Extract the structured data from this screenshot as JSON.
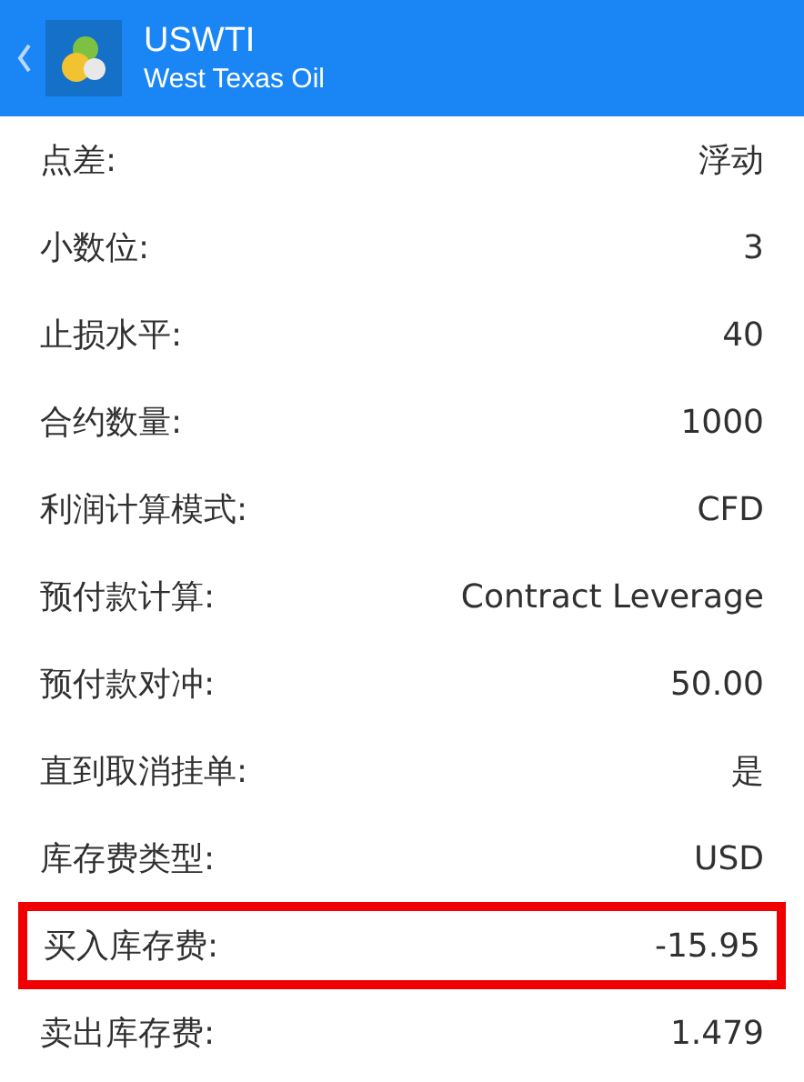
{
  "header": {
    "title": "USWTI",
    "subtitle": "West Texas Oil"
  },
  "rows": [
    {
      "label": "点差:",
      "value": "浮动",
      "highlighted": false
    },
    {
      "label": "小数位:",
      "value": "3",
      "highlighted": false
    },
    {
      "label": "止损水平:",
      "value": "40",
      "highlighted": false
    },
    {
      "label": "合约数量:",
      "value": "1000",
      "highlighted": false
    },
    {
      "label": "利润计算模式:",
      "value": "CFD",
      "highlighted": false
    },
    {
      "label": "预付款计算:",
      "value": "Contract Leverage",
      "highlighted": false
    },
    {
      "label": "预付款对冲:",
      "value": "50.00",
      "highlighted": false
    },
    {
      "label": "直到取消挂单:",
      "value": "是",
      "highlighted": false
    },
    {
      "label": "库存费类型:",
      "value": "USD",
      "highlighted": false
    },
    {
      "label": "买入库存费:",
      "value": "-15.95",
      "highlighted": true
    },
    {
      "label": "卖出库存费:",
      "value": "1.479",
      "highlighted": false
    }
  ]
}
